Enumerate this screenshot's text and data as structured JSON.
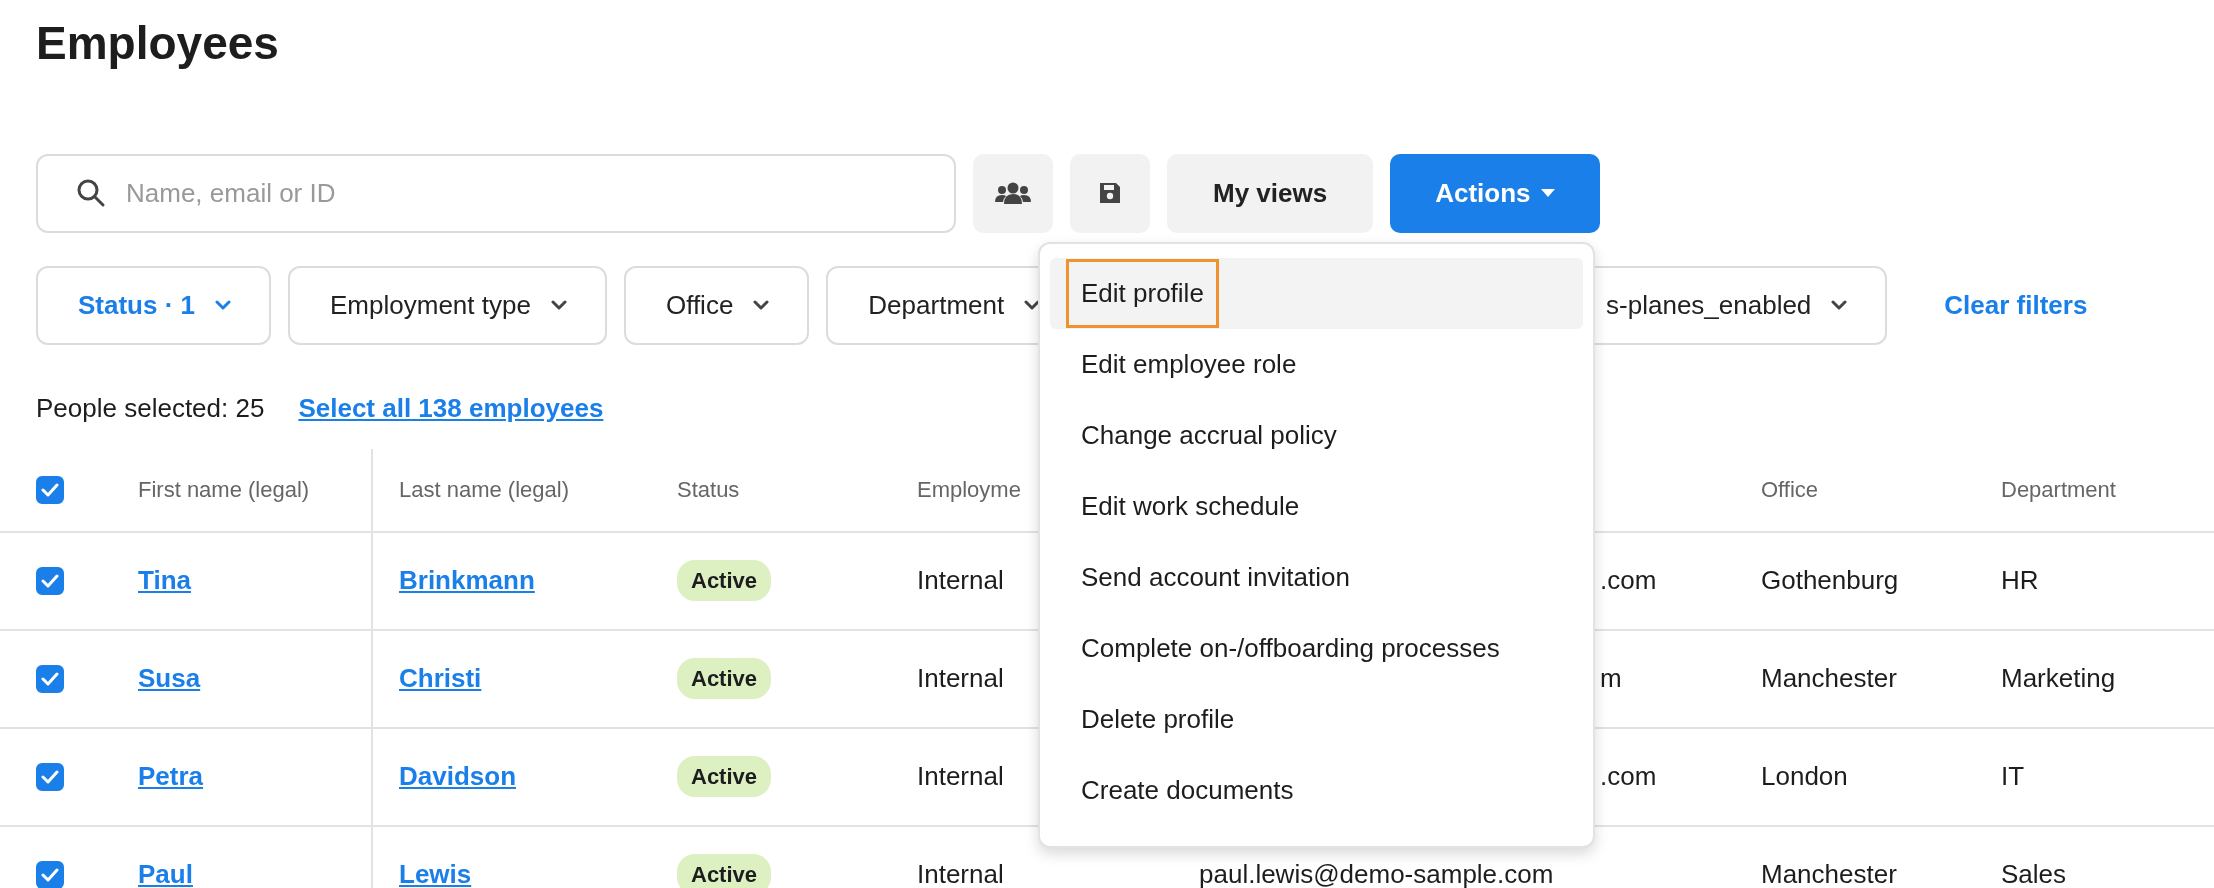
{
  "title": "Employees",
  "search": {
    "placeholder": "Name, email or ID"
  },
  "toolbar": {
    "my_views": "My views",
    "actions": "Actions"
  },
  "filters": [
    {
      "label": "Status · 1",
      "active": true,
      "cut": false
    },
    {
      "label": "Employment type",
      "active": false,
      "cut": false
    },
    {
      "label": "Office",
      "active": false,
      "cut": false
    },
    {
      "label": "Department",
      "active": false,
      "cut": false
    },
    {
      "label": "s-planes_enabled",
      "active": false,
      "cut": true
    }
  ],
  "clear_filters": "Clear filters",
  "selection": {
    "text": "People selected: 25",
    "link": "Select all 138 employees"
  },
  "table": {
    "all_checked": true,
    "columns": [
      "First name (legal)",
      "Last name (legal)",
      "Status",
      "Employme",
      "Office",
      "Department"
    ],
    "rows": [
      {
        "checked": true,
        "first": "Tina",
        "last": "Brinkmann",
        "status": "Active",
        "employment": "Internal",
        "email": {
          "text": ".com",
          "cut": true
        },
        "office": "Gothenburg",
        "department": "HR"
      },
      {
        "checked": true,
        "first": "Susa",
        "last": "Christi",
        "status": "Active",
        "employment": "Internal",
        "email": {
          "text": "m",
          "cut": true
        },
        "office": "Manchester",
        "department": "Marketing"
      },
      {
        "checked": true,
        "first": "Petra",
        "last": "Davidson",
        "status": "Active",
        "employment": "Internal",
        "email": {
          "text": ".com",
          "cut": true
        },
        "office": "London",
        "department": "IT"
      },
      {
        "checked": true,
        "first": "Paul",
        "last": "Lewis",
        "status": "Active",
        "employment": "Internal",
        "email": {
          "text": "paul.lewis@demo-sample.com",
          "cut": false
        },
        "office": "Manchester",
        "department": "Sales"
      }
    ]
  },
  "actions_menu": {
    "items": [
      {
        "label": "Edit profile",
        "selected": true
      },
      {
        "label": "Edit employee role",
        "selected": false
      },
      {
        "label": "Change accrual policy",
        "selected": false
      },
      {
        "label": "Edit work schedule",
        "selected": false
      },
      {
        "label": "Send account invitation",
        "selected": false
      },
      {
        "label": "Complete on-/offboarding processes",
        "selected": false
      },
      {
        "label": "Delete profile",
        "selected": false
      },
      {
        "label": "Create documents",
        "selected": false
      }
    ]
  }
}
